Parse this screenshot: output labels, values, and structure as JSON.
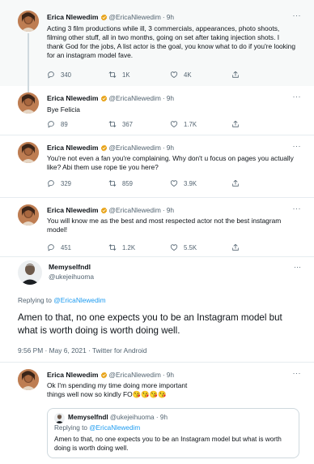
{
  "colors": {
    "accent": "#1d9bf0",
    "verified_gold": "#e8a317",
    "muted": "#536471"
  },
  "icons": [
    "reply-icon",
    "retweet-icon",
    "like-icon",
    "share-icon",
    "verified-badge-icon",
    "more-icon"
  ],
  "tweets": [
    {
      "name": "Erica Nlewedim",
      "handle": "@EricaNlewedim",
      "sep": "·",
      "time": "9h",
      "more": "···",
      "text": "Acting 3 film productions while ill, 3 commercials, appearances, photo shoots, filming other stuff, all in two months, going on set after taking injection shots. I thank God for the jobs, A list actor is the goal, you know what to do if you're looking for an instagram model fave.",
      "replies": "340",
      "retweets": "1K",
      "likes": "4K"
    },
    {
      "name": "Erica Nlewedim",
      "handle": "@EricaNlewedim",
      "sep": "·",
      "time": "9h",
      "more": "···",
      "text": "Bye Felicia",
      "replies": "89",
      "retweets": "367",
      "likes": "1.7K"
    },
    {
      "name": "Erica Nlewedim",
      "handle": "@EricaNlewedim",
      "sep": "·",
      "time": "9h",
      "more": "···",
      "text": "You're not even a fan you're complaining. Why don't u focus on pages you actually like? Abi them use rope tie you here?",
      "replies": "329",
      "retweets": "859",
      "likes": "3.9K"
    },
    {
      "name": "Erica Nlewedim",
      "handle": "@EricaNlewedim",
      "sep": "·",
      "time": "9h",
      "more": "···",
      "text": "You will know me as the best and most respected actor not the best instagram model!",
      "replies": "451",
      "retweets": "1.2K",
      "likes": "5.5K"
    }
  ],
  "main_tweet": {
    "name": "Memyselfndl",
    "handle": "@ukejeihuoma",
    "more": "···",
    "replying_prefix": "Replying to",
    "replying_to": "@EricaNlewedim",
    "text": "Amen to that, no one expects you to be an Instagram model but what is worth doing is worth doing well.",
    "meta": "9:56 PM · May 6, 2021 · Twitter for Android"
  },
  "reply": {
    "name": "Erica Nlewedim",
    "handle": "@EricaNlewedim",
    "sep": "·",
    "time": "9h",
    "more": "···",
    "text": "Ok I'm spending my time doing more important things well now so kindly FO😘😘😘😘",
    "quote": {
      "name": "Memyselfndl",
      "handle": "@ukejeihuoma",
      "sep": "·",
      "time": "9h",
      "replying_prefix": "Replying to",
      "replying_to": "@EricaNlewedim",
      "text": "Amen to that, no one expects you to be an Instagram model but what is worth doing is worth doing well."
    }
  }
}
